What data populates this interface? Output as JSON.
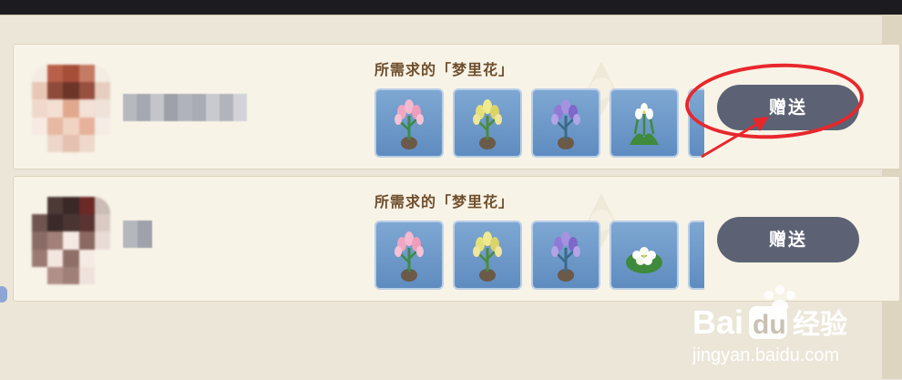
{
  "requests": [
    {
      "title": "所需求的「梦里花」",
      "button_label": "赠送",
      "flowers": [
        "pink-lily-flower-icon",
        "yellow-lily-flower-icon",
        "purple-lily-flower-icon",
        "white-bell-flower-icon",
        "partial-flower-icon"
      ]
    },
    {
      "title": "所需求的「梦里花」",
      "button_label": "赠送",
      "flowers": [
        "pink-lily-flower-icon",
        "yellow-lily-flower-icon",
        "purple-lily-flower-icon",
        "white-cluster-flower-icon",
        "partial-flower-icon"
      ]
    }
  ],
  "watermark": {
    "brand": "Bai",
    "brand_box": "du",
    "brand_cn": "经验",
    "url": "jingyan.baidu.com"
  },
  "colors": {
    "button_bg": "#5c6273",
    "title_text": "#6e4f2c",
    "annotation_red": "#e8272c",
    "flower_slot_blue": "#6f9ac9"
  }
}
